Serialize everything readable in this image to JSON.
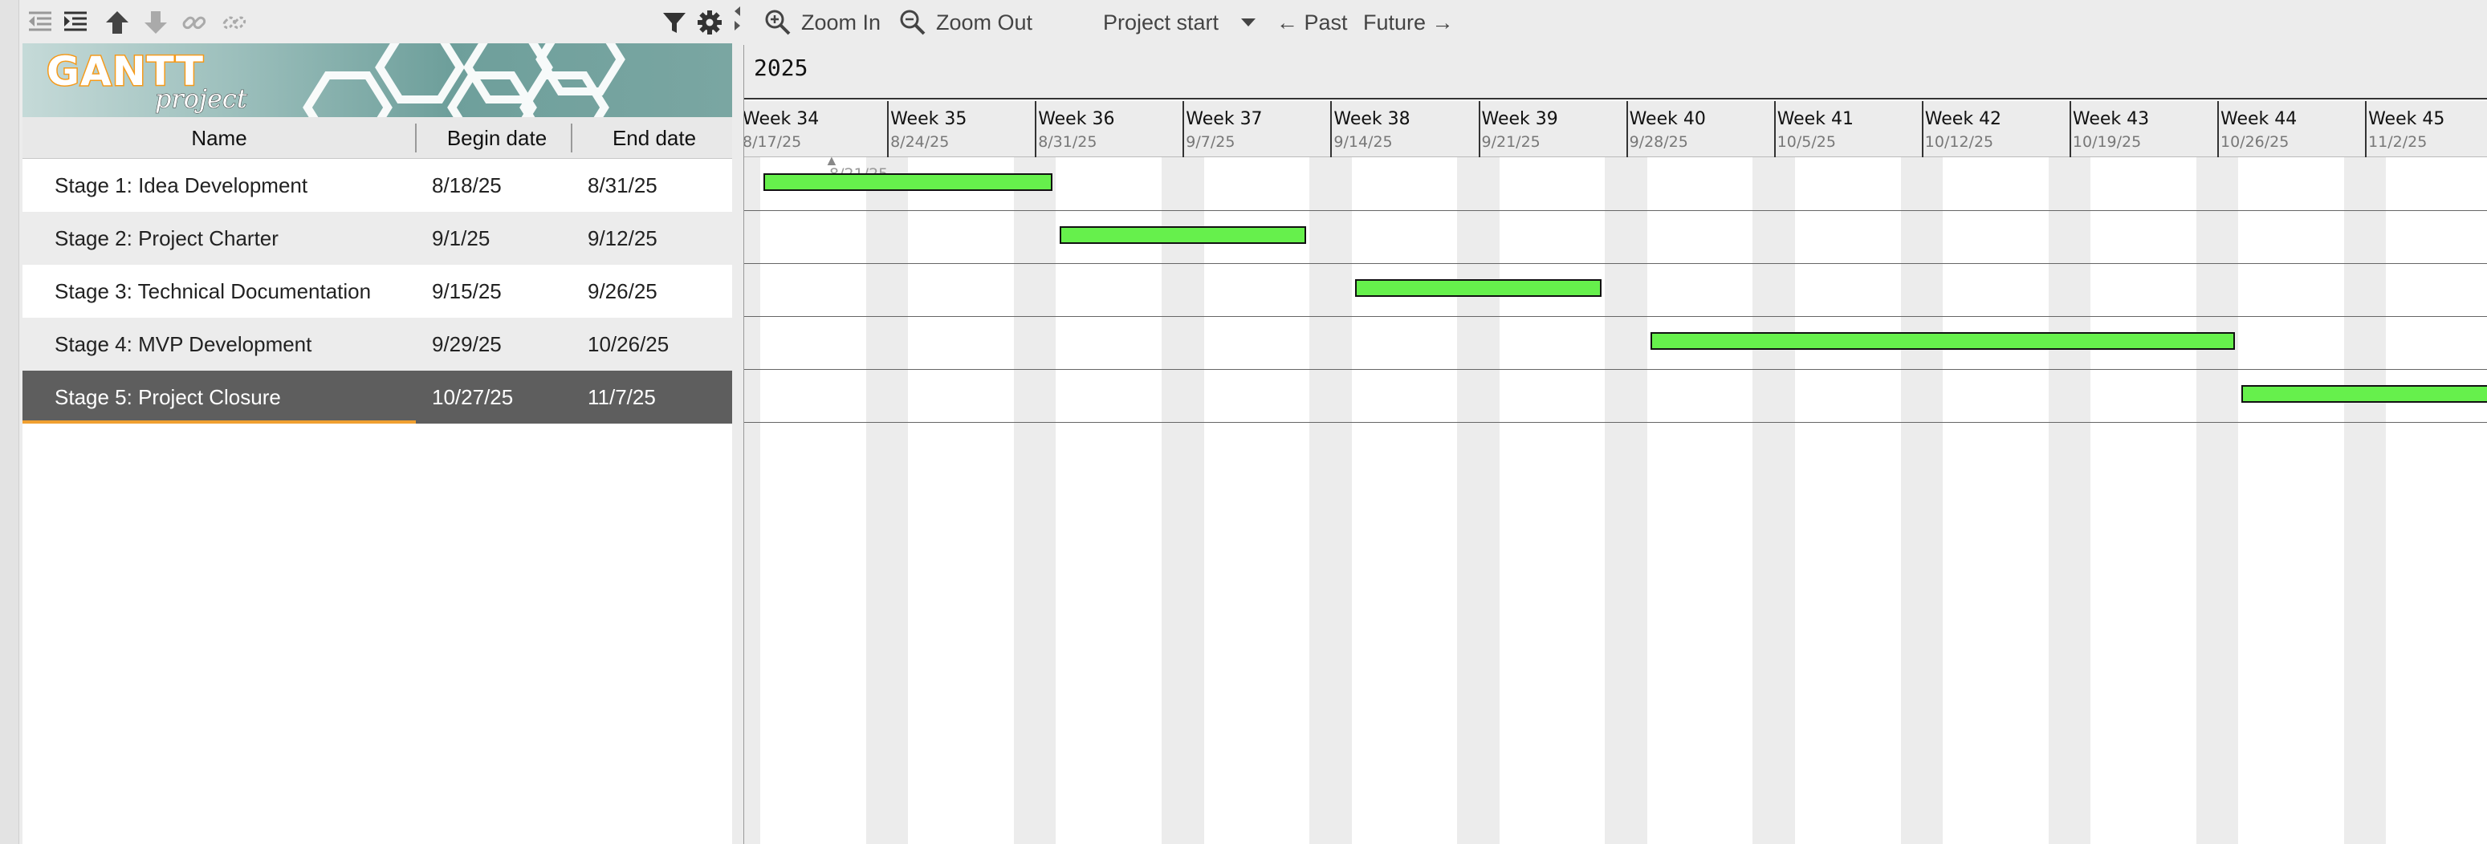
{
  "toolbar_left": {
    "icons": [
      "outdent-icon",
      "indent-icon",
      "move-up-icon",
      "move-down-icon",
      "link-icon",
      "unlink-icon",
      "filter-icon",
      "gear-icon"
    ]
  },
  "logo": {
    "text": "GANTT",
    "sub": "project"
  },
  "table": {
    "headers": {
      "name": "Name",
      "begin": "Begin date",
      "end": "End date"
    },
    "rows": [
      {
        "name": "Stage 1: Idea Development",
        "begin": "8/18/25",
        "end": "8/31/25"
      },
      {
        "name": "Stage 2: Project Charter",
        "begin": "9/1/25",
        "end": "9/12/25"
      },
      {
        "name": "Stage 3: Technical Documentation",
        "begin": "9/15/25",
        "end": "9/26/25"
      },
      {
        "name": "Stage 4: MVP Development",
        "begin": "9/29/25",
        "end": "10/26/25"
      },
      {
        "name": "Stage 5: Project Closure",
        "begin": "10/27/25",
        "end": "11/7/25",
        "selected": true
      }
    ]
  },
  "chart_toolbar": {
    "zoom_in": "Zoom In",
    "zoom_out": "Zoom Out",
    "project_start": "Project start",
    "past": "← Past",
    "future": "Future →"
  },
  "timeline": {
    "year": "2025",
    "weeks": [
      {
        "label": "Week 34",
        "date": "8/17/25"
      },
      {
        "label": "Week 35",
        "date": "8/24/25"
      },
      {
        "label": "Week 36",
        "date": "8/31/25"
      },
      {
        "label": "Week 37",
        "date": "9/7/25"
      },
      {
        "label": "Week 38",
        "date": "9/14/25"
      },
      {
        "label": "Week 39",
        "date": "9/21/25"
      },
      {
        "label": "Week 40",
        "date": "9/28/25"
      },
      {
        "label": "Week 41",
        "date": "10/5/25"
      },
      {
        "label": "Week 42",
        "date": "10/12/25"
      },
      {
        "label": "Week 43",
        "date": "10/19/25"
      },
      {
        "label": "Week 44",
        "date": "10/26/25"
      },
      {
        "label": "Week 45",
        "date": "11/2/25"
      }
    ],
    "today_label": "8/21/25"
  },
  "colors": {
    "bar": "#66f04c",
    "selection": "#5e5e5e",
    "accent": "#f0a030"
  }
}
